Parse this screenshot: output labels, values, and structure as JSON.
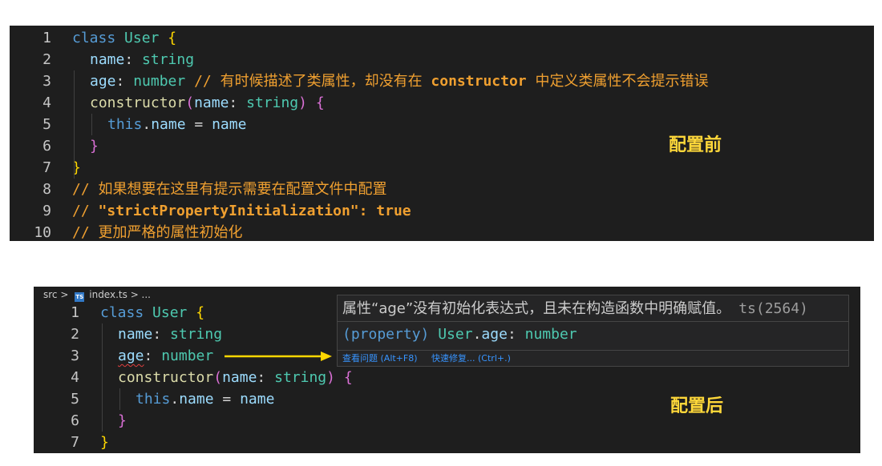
{
  "top": {
    "lines": [
      {
        "n": "1",
        "parts": [
          [
            "kw",
            "class "
          ],
          [
            "cls",
            "User "
          ],
          [
            "brace1",
            "{"
          ]
        ]
      },
      {
        "n": "2",
        "parts": [
          [
            "prop",
            "name"
          ],
          [
            "punc",
            ": "
          ],
          [
            "type",
            "string"
          ]
        ]
      },
      {
        "n": "3",
        "parts": [
          [
            "prop",
            "age"
          ],
          [
            "punc",
            ": "
          ],
          [
            "type",
            "number "
          ],
          [
            "cmt",
            "// 有时候描述了类属性，却没有在 "
          ],
          [
            "cmtb",
            "constructor"
          ],
          [
            "cmt",
            " 中定义类属性不会提示错误"
          ]
        ]
      },
      {
        "n": "4",
        "parts": [
          [
            "fn",
            "constructor"
          ],
          [
            "brace2",
            "("
          ],
          [
            "prop",
            "name"
          ],
          [
            "punc",
            ": "
          ],
          [
            "type",
            "string"
          ],
          [
            "brace2",
            ")"
          ],
          [
            "punc",
            " "
          ],
          [
            "brace2",
            "{"
          ]
        ]
      },
      {
        "n": "5",
        "parts": [
          [
            "this",
            "this"
          ],
          [
            "punc",
            "."
          ],
          [
            "prop",
            "name"
          ],
          [
            "punc",
            " = "
          ],
          [
            "prop",
            "name"
          ]
        ]
      },
      {
        "n": "6",
        "parts": [
          [
            "brace2",
            "}"
          ]
        ]
      },
      {
        "n": "7",
        "parts": [
          [
            "brace1",
            "}"
          ]
        ]
      },
      {
        "n": "8",
        "parts": [
          [
            "cmt",
            "// 如果想要在这里有提示需要在配置文件中配置"
          ]
        ]
      },
      {
        "n": "9",
        "parts": [
          [
            "cmt",
            "// "
          ],
          [
            "cmtb",
            "\"strictPropertyInitialization\": true"
          ]
        ]
      },
      {
        "n": "10",
        "parts": [
          [
            "cmt",
            "// 更加严格的属性初始化"
          ]
        ]
      }
    ],
    "label": "配置前"
  },
  "bottom": {
    "breadcrumb": {
      "folder": "src",
      "sep": ">",
      "icon": "TS",
      "file": "index.ts",
      "tail": "> ..."
    },
    "lines": [
      {
        "n": "1",
        "parts": [
          [
            "kw",
            "class "
          ],
          [
            "cls",
            "User "
          ],
          [
            "brace1",
            "{"
          ]
        ]
      },
      {
        "n": "2",
        "parts": [
          [
            "prop",
            "name"
          ],
          [
            "punc",
            ": "
          ],
          [
            "type",
            "string"
          ]
        ]
      },
      {
        "n": "3",
        "parts": [
          [
            "prop squiggle",
            "age"
          ],
          [
            "punc",
            ": "
          ],
          [
            "type",
            "number"
          ]
        ]
      },
      {
        "n": "4",
        "parts": [
          [
            "fn",
            "constructor"
          ],
          [
            "brace2",
            "("
          ],
          [
            "prop",
            "name"
          ],
          [
            "punc",
            ": "
          ],
          [
            "type",
            "string"
          ],
          [
            "brace2",
            ")"
          ],
          [
            "punc",
            " "
          ],
          [
            "brace2",
            "{"
          ]
        ]
      },
      {
        "n": "5",
        "parts": [
          [
            "this",
            "this"
          ],
          [
            "punc",
            "."
          ],
          [
            "prop",
            "name"
          ],
          [
            "punc",
            " = "
          ],
          [
            "prop",
            "name"
          ]
        ]
      },
      {
        "n": "6",
        "parts": [
          [
            "brace2",
            "}"
          ]
        ]
      },
      {
        "n": "7",
        "parts": [
          [
            "brace1",
            "}"
          ]
        ]
      }
    ],
    "label": "配置后",
    "tooltip": {
      "title": "属性“age”没有初始化表达式，且未在构造函数中明确赋值。",
      "code": "ts(2564)",
      "sig_parts": [
        [
          "kw",
          "(property) "
        ],
        [
          "cls",
          "User"
        ],
        [
          "punc",
          "."
        ],
        [
          "prop",
          "age"
        ],
        [
          "punc",
          ": "
        ],
        [
          "type",
          "number"
        ]
      ],
      "action_view": "查看问题 (Alt+F8)",
      "action_fix": "快速修复... (Ctrl+.)"
    }
  },
  "colors": {
    "editor_bg": "#1e1e1e",
    "label": "#ffd83a",
    "arrow": "#ffd700",
    "error_squiggle": "#e04040"
  }
}
